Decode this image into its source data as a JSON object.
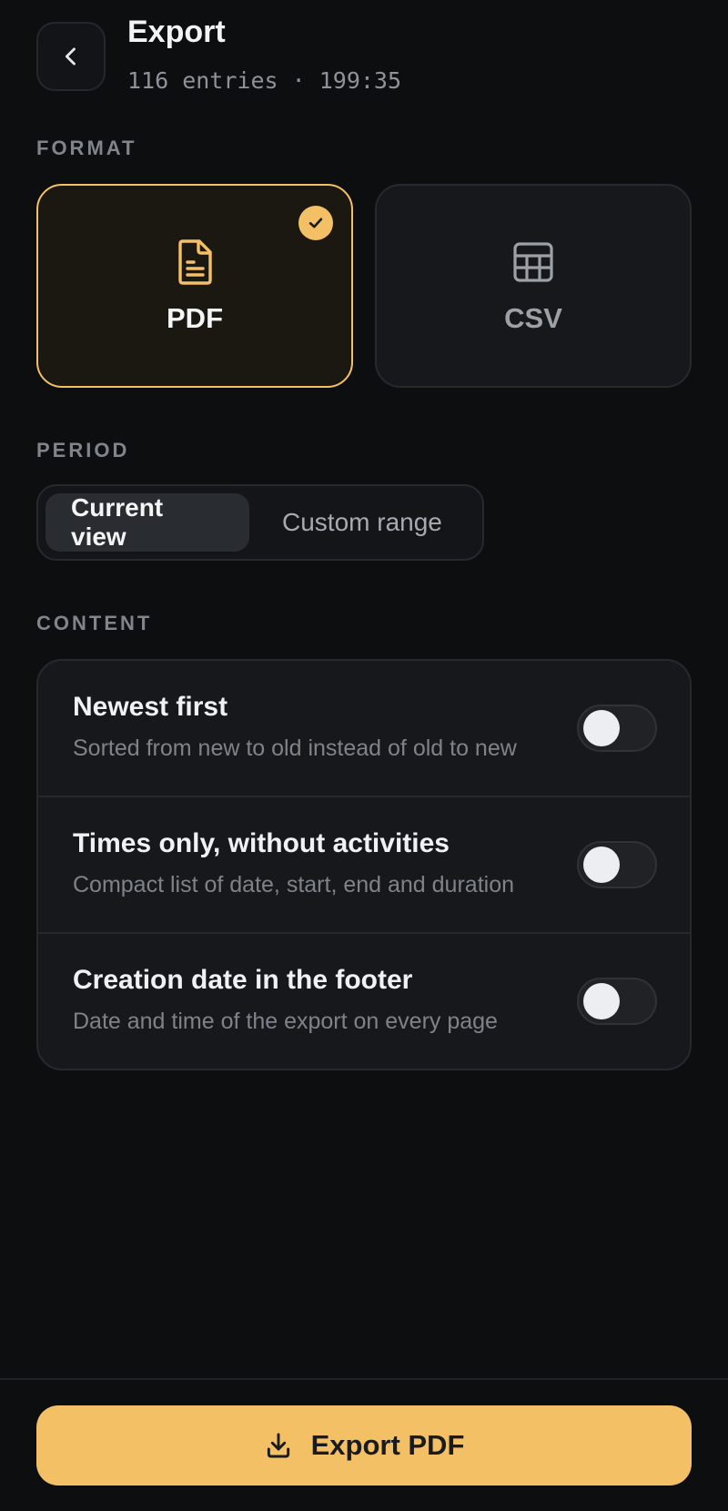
{
  "header": {
    "title": "Export",
    "subtitle": "116 entries · 199:35"
  },
  "format": {
    "label": "FORMAT",
    "options": [
      {
        "label": "PDF",
        "icon": "document-icon",
        "selected": true
      },
      {
        "label": "CSV",
        "icon": "table-icon",
        "selected": false
      }
    ]
  },
  "period": {
    "label": "PERIOD",
    "options": [
      {
        "label": "Current view",
        "active": true
      },
      {
        "label": "Custom range",
        "active": false
      }
    ]
  },
  "content": {
    "label": "CONTENT",
    "options": [
      {
        "title": "Newest first",
        "description": "Sorted from new to old instead of old to new",
        "enabled": false
      },
      {
        "title": "Times only, without activities",
        "description": "Compact list of date, start, end and duration",
        "enabled": false
      },
      {
        "title": "Creation date in the footer",
        "description": "Date and time of the export on every page",
        "enabled": false
      }
    ]
  },
  "footer": {
    "export_label": "Export PDF",
    "icon": "download-icon"
  },
  "colors": {
    "accent": "#f4c066",
    "background": "#0d0e10",
    "card": "#17181b"
  }
}
